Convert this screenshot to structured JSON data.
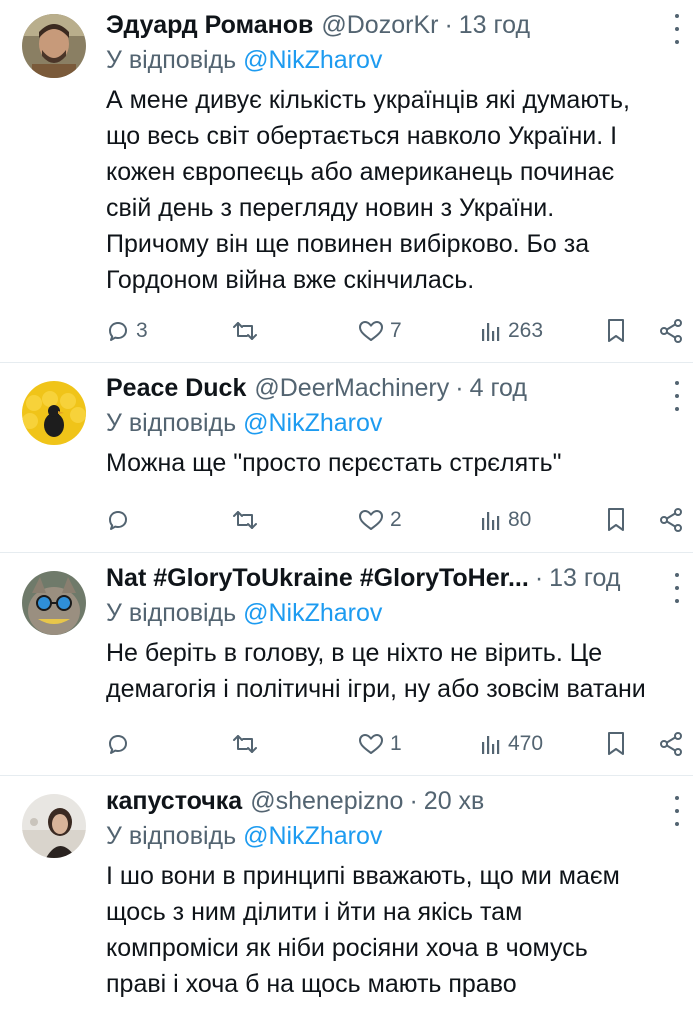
{
  "tweets": [
    {
      "name": "Эдуард Романов",
      "handle": "@DozorKr",
      "time": "13 год",
      "reply_prefix": "У відповідь ",
      "reply_to": "@NikZharov",
      "text": "А мене дивує кількість українців які думають,\nщо весь світ обертається навколо України. І\nкожен європеєць або американець починає\nсвій день з перегляду новин з України.\nПричому він ще повинен вибірково. Бо за\nГордоном війна вже скінчилась.",
      "replies": "3",
      "retweets": "",
      "likes": "7",
      "views": "263"
    },
    {
      "name": "Peace Duck",
      "handle": "@DeerMachinery",
      "time": "4 год",
      "reply_prefix": "У відповідь ",
      "reply_to": "@NikZharov",
      "text": "Можна ще \"просто пєрєстать стрєлять\"",
      "replies": "",
      "retweets": "",
      "likes": "2",
      "views": "80"
    },
    {
      "name": "Nat #GloryToUkraine #GloryToHer...",
      "handle": "",
      "time": "13 год",
      "reply_prefix": "У відповідь ",
      "reply_to": "@NikZharov",
      "text": "Не беріть в голову, в це ніхто не вірить. Це\nдемагогія і політичні ігри, ну або зовсім ватани",
      "replies": "",
      "retweets": "",
      "likes": "1",
      "views": "470"
    },
    {
      "name": "капусточка",
      "handle": "@shenepizno",
      "time": "20 хв",
      "reply_prefix": "У відповідь ",
      "reply_to": "@NikZharov",
      "text": "І шо вони в принципі вважають, що ми маєм\nщось з ним ділити і йти на якісь там\nкомпроміси як ніби росіяни хоча в чомусь\nправі і хоча б на щось мають право",
      "replies": "",
      "retweets": "",
      "likes": "",
      "views": ""
    }
  ],
  "icons": {
    "reply": "reply-icon",
    "retweet": "retweet-icon",
    "like": "heart-icon",
    "views": "views-icon",
    "bookmark": "bookmark-icon",
    "share": "share-icon",
    "more": "more-icon"
  },
  "colors": {
    "link": "#1d9bf0",
    "secondary": "#536471",
    "text": "#0f1419",
    "divider": "#e6ecf0"
  }
}
